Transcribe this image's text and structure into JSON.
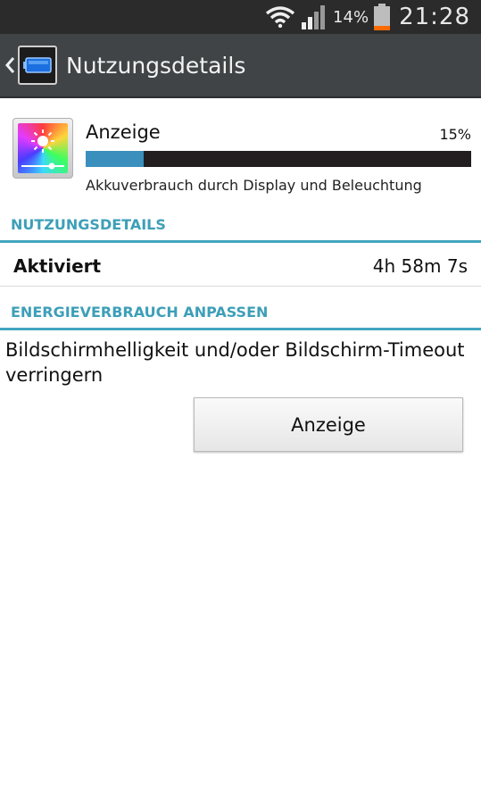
{
  "status_bar": {
    "battery_percent": "14%",
    "time": "21:28"
  },
  "action_bar": {
    "title": "Nutzungsdetails"
  },
  "usage": {
    "name": "Anzeige",
    "percent_label": "15%",
    "fraction": 0.15,
    "description": "Akkuverbrauch durch Display und Beleuchtung"
  },
  "sections": {
    "usage_details_header": "NUTZUNGSDETAILS",
    "adjust_header": "ENERGIEVERBRAUCH ANPASSEN"
  },
  "details": {
    "activated_label": "Aktiviert",
    "activated_value": "4h 58m 7s"
  },
  "adjust": {
    "hint": "Bildschirmhelligkeit und/oder Bildschirm-Timeout verringern",
    "button_label": "Anzeige"
  },
  "colors": {
    "accent": "#3d9fb8",
    "bar_fill": "#3a8fbd",
    "bar_track": "#231f20",
    "action_bar": "#404447"
  }
}
